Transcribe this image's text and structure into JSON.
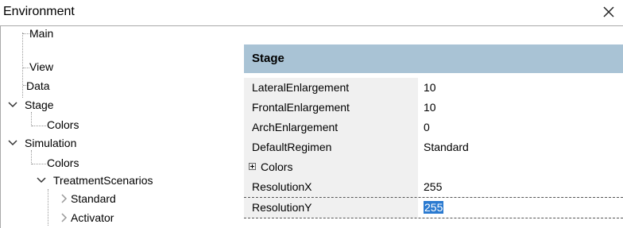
{
  "window": {
    "title": "Environment",
    "close_glyph": "close-icon"
  },
  "tree": {
    "items": [
      {
        "label": "Main"
      },
      {
        "label": "View"
      },
      {
        "label": "Data"
      },
      {
        "label": "Stage",
        "expanded": true
      },
      {
        "label": "Colors"
      },
      {
        "label": "Simulation",
        "expanded": true
      },
      {
        "label": "Colors"
      },
      {
        "label": "TreatmentScenarios",
        "expanded": true
      },
      {
        "label": "Standard",
        "expanded": false
      },
      {
        "label": "Activator",
        "expanded": false
      }
    ]
  },
  "properties": {
    "section": "Stage",
    "rows": [
      {
        "name": "LateralEnlargement",
        "value": "10"
      },
      {
        "name": "FrontalEnlargement",
        "value": "10"
      },
      {
        "name": "ArchEnlargement",
        "value": "0"
      },
      {
        "name": "DefaultRegimen",
        "value": "Standard"
      },
      {
        "name": "Colors",
        "value": ""
      },
      {
        "name": "ResolutionX",
        "value": "255"
      },
      {
        "name": "ResolutionY",
        "value": "255"
      }
    ]
  },
  "colors": {
    "header_bg": "#a9c3d5",
    "selection": "#2a7ad0",
    "zebra": "#f0f0f0"
  }
}
